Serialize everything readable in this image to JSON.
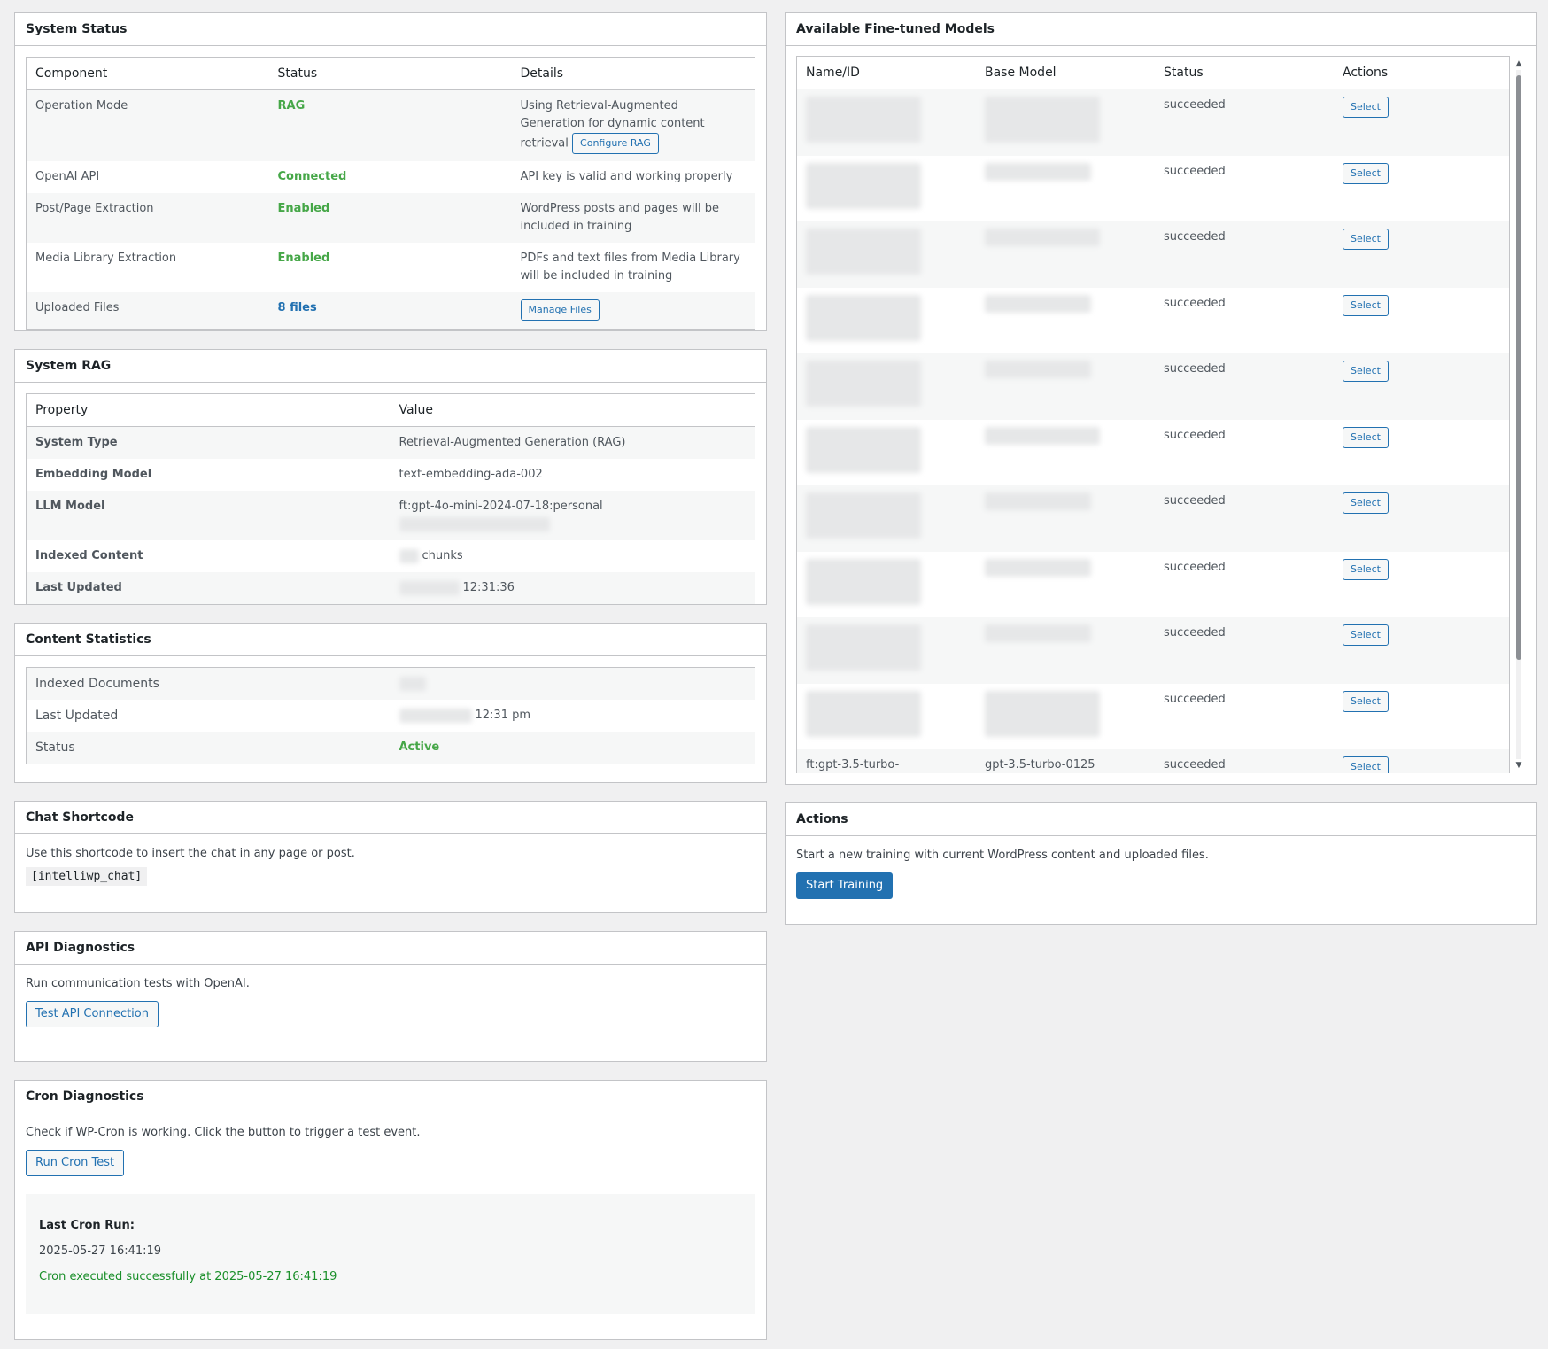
{
  "system_status": {
    "title": "System Status",
    "headers": [
      "Component",
      "Status",
      "Details"
    ],
    "rows": [
      {
        "component": "Operation Mode",
        "status": "RAG",
        "details": "Using Retrieval-Augmented Generation for dynamic content retrieval",
        "button": "Configure RAG"
      },
      {
        "component": "OpenAI API",
        "status": "Connected",
        "details": "API key is valid and working properly"
      },
      {
        "component": "Post/Page Extraction",
        "status": "Enabled",
        "details": "WordPress posts and pages will be included in training"
      },
      {
        "component": "Media Library Extraction",
        "status": "Enabled",
        "details": "PDFs and text files from Media Library will be included in training"
      },
      {
        "component": "Uploaded Files",
        "status": "8 files",
        "button": "Manage Files"
      }
    ]
  },
  "system_rag": {
    "title": "System RAG",
    "headers": [
      "Property",
      "Value"
    ],
    "rows": [
      {
        "property": "System Type",
        "value": "Retrieval-Augmented Generation (RAG)"
      },
      {
        "property": "Embedding Model",
        "value": "text-embedding-ada-002"
      },
      {
        "property": "LLM Model",
        "value": "ft:gpt-4o-mini-2024-07-18:personal"
      },
      {
        "property": "Indexed Content",
        "value": "chunks"
      },
      {
        "property": "Last Updated",
        "value": "12:31:36"
      }
    ]
  },
  "content_statistics": {
    "title": "Content Statistics",
    "rows": [
      {
        "label": "Indexed Documents",
        "value": ""
      },
      {
        "label": "Last Updated",
        "value": "12:31 pm"
      },
      {
        "label": "Status",
        "value": "Active"
      }
    ]
  },
  "chat_shortcode": {
    "title": "Chat Shortcode",
    "description": "Use this shortcode to insert the chat in any page or post.",
    "shortcode": "[intelliwp_chat]"
  },
  "api_diagnostics": {
    "title": "API Diagnostics",
    "description": "Run communication tests with OpenAI.",
    "button": "Test API Connection"
  },
  "cron_diagnostics": {
    "title": "Cron Diagnostics",
    "description": "Check if WP-Cron is working. Click the button to trigger a test event.",
    "button": "Run Cron Test",
    "last_run_label": "Last Cron Run:",
    "last_run_value": "2025-05-27 16:41:19",
    "message": "Cron executed successfully at 2025-05-27 16:41:19"
  },
  "fine_tuned_models": {
    "title": "Available Fine-tuned Models",
    "headers": [
      "Name/ID",
      "Base Model",
      "Status",
      "Actions"
    ],
    "select_label": "Select",
    "rows": [
      {
        "status": "succeeded"
      },
      {
        "status": "succeeded"
      },
      {
        "status": "succeeded"
      },
      {
        "status": "succeeded"
      },
      {
        "status": "succeeded"
      },
      {
        "status": "succeeded"
      },
      {
        "status": "succeeded"
      },
      {
        "status": "succeeded"
      },
      {
        "status": "succeeded"
      },
      {
        "status": "succeeded"
      },
      {
        "name": "ft:gpt-3.5-turbo-",
        "base": "gpt-3.5-turbo-0125",
        "status": "succeeded"
      }
    ]
  },
  "actions": {
    "title": "Actions",
    "description": "Start a new training with current WordPress content and uploaded files.",
    "button": "Start Training"
  },
  "colors": {
    "accent": "#2271b1",
    "success": "#46a748",
    "background": "#f0f0f1"
  }
}
